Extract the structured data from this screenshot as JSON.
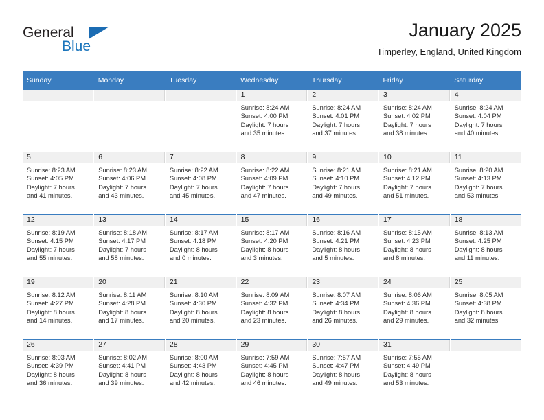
{
  "brand": {
    "name_part1": "General",
    "name_part2": "Blue",
    "accent_color": "#1b75bc",
    "triangle_color": "#1b6cb3"
  },
  "header": {
    "title": "January 2025",
    "subtitle": "Timperley, England, United Kingdom"
  },
  "theme": {
    "header_row_bg": "#3a7dc0",
    "daynum_band_bg": "#f0f0f0",
    "week_separator": "#3a7dc0",
    "text_color": "#1a1a1a"
  },
  "weekdays": [
    "Sunday",
    "Monday",
    "Tuesday",
    "Wednesday",
    "Thursday",
    "Friday",
    "Saturday"
  ],
  "weeks": [
    [
      {
        "day": "",
        "empty": true
      },
      {
        "day": "",
        "empty": true
      },
      {
        "day": "",
        "empty": true
      },
      {
        "day": "1",
        "sunrise": "Sunrise: 8:24 AM",
        "sunset": "Sunset: 4:00 PM",
        "daylight1": "Daylight: 7 hours",
        "daylight2": "and 35 minutes."
      },
      {
        "day": "2",
        "sunrise": "Sunrise: 8:24 AM",
        "sunset": "Sunset: 4:01 PM",
        "daylight1": "Daylight: 7 hours",
        "daylight2": "and 37 minutes."
      },
      {
        "day": "3",
        "sunrise": "Sunrise: 8:24 AM",
        "sunset": "Sunset: 4:02 PM",
        "daylight1": "Daylight: 7 hours",
        "daylight2": "and 38 minutes."
      },
      {
        "day": "4",
        "sunrise": "Sunrise: 8:24 AM",
        "sunset": "Sunset: 4:04 PM",
        "daylight1": "Daylight: 7 hours",
        "daylight2": "and 40 minutes."
      }
    ],
    [
      {
        "day": "5",
        "sunrise": "Sunrise: 8:23 AM",
        "sunset": "Sunset: 4:05 PM",
        "daylight1": "Daylight: 7 hours",
        "daylight2": "and 41 minutes."
      },
      {
        "day": "6",
        "sunrise": "Sunrise: 8:23 AM",
        "sunset": "Sunset: 4:06 PM",
        "daylight1": "Daylight: 7 hours",
        "daylight2": "and 43 minutes."
      },
      {
        "day": "7",
        "sunrise": "Sunrise: 8:22 AM",
        "sunset": "Sunset: 4:08 PM",
        "daylight1": "Daylight: 7 hours",
        "daylight2": "and 45 minutes."
      },
      {
        "day": "8",
        "sunrise": "Sunrise: 8:22 AM",
        "sunset": "Sunset: 4:09 PM",
        "daylight1": "Daylight: 7 hours",
        "daylight2": "and 47 minutes."
      },
      {
        "day": "9",
        "sunrise": "Sunrise: 8:21 AM",
        "sunset": "Sunset: 4:10 PM",
        "daylight1": "Daylight: 7 hours",
        "daylight2": "and 49 minutes."
      },
      {
        "day": "10",
        "sunrise": "Sunrise: 8:21 AM",
        "sunset": "Sunset: 4:12 PM",
        "daylight1": "Daylight: 7 hours",
        "daylight2": "and 51 minutes."
      },
      {
        "day": "11",
        "sunrise": "Sunrise: 8:20 AM",
        "sunset": "Sunset: 4:13 PM",
        "daylight1": "Daylight: 7 hours",
        "daylight2": "and 53 minutes."
      }
    ],
    [
      {
        "day": "12",
        "sunrise": "Sunrise: 8:19 AM",
        "sunset": "Sunset: 4:15 PM",
        "daylight1": "Daylight: 7 hours",
        "daylight2": "and 55 minutes."
      },
      {
        "day": "13",
        "sunrise": "Sunrise: 8:18 AM",
        "sunset": "Sunset: 4:17 PM",
        "daylight1": "Daylight: 7 hours",
        "daylight2": "and 58 minutes."
      },
      {
        "day": "14",
        "sunrise": "Sunrise: 8:17 AM",
        "sunset": "Sunset: 4:18 PM",
        "daylight1": "Daylight: 8 hours",
        "daylight2": "and 0 minutes."
      },
      {
        "day": "15",
        "sunrise": "Sunrise: 8:17 AM",
        "sunset": "Sunset: 4:20 PM",
        "daylight1": "Daylight: 8 hours",
        "daylight2": "and 3 minutes."
      },
      {
        "day": "16",
        "sunrise": "Sunrise: 8:16 AM",
        "sunset": "Sunset: 4:21 PM",
        "daylight1": "Daylight: 8 hours",
        "daylight2": "and 5 minutes."
      },
      {
        "day": "17",
        "sunrise": "Sunrise: 8:15 AM",
        "sunset": "Sunset: 4:23 PM",
        "daylight1": "Daylight: 8 hours",
        "daylight2": "and 8 minutes."
      },
      {
        "day": "18",
        "sunrise": "Sunrise: 8:13 AM",
        "sunset": "Sunset: 4:25 PM",
        "daylight1": "Daylight: 8 hours",
        "daylight2": "and 11 minutes."
      }
    ],
    [
      {
        "day": "19",
        "sunrise": "Sunrise: 8:12 AM",
        "sunset": "Sunset: 4:27 PM",
        "daylight1": "Daylight: 8 hours",
        "daylight2": "and 14 minutes."
      },
      {
        "day": "20",
        "sunrise": "Sunrise: 8:11 AM",
        "sunset": "Sunset: 4:28 PM",
        "daylight1": "Daylight: 8 hours",
        "daylight2": "and 17 minutes."
      },
      {
        "day": "21",
        "sunrise": "Sunrise: 8:10 AM",
        "sunset": "Sunset: 4:30 PM",
        "daylight1": "Daylight: 8 hours",
        "daylight2": "and 20 minutes."
      },
      {
        "day": "22",
        "sunrise": "Sunrise: 8:09 AM",
        "sunset": "Sunset: 4:32 PM",
        "daylight1": "Daylight: 8 hours",
        "daylight2": "and 23 minutes."
      },
      {
        "day": "23",
        "sunrise": "Sunrise: 8:07 AM",
        "sunset": "Sunset: 4:34 PM",
        "daylight1": "Daylight: 8 hours",
        "daylight2": "and 26 minutes."
      },
      {
        "day": "24",
        "sunrise": "Sunrise: 8:06 AM",
        "sunset": "Sunset: 4:36 PM",
        "daylight1": "Daylight: 8 hours",
        "daylight2": "and 29 minutes."
      },
      {
        "day": "25",
        "sunrise": "Sunrise: 8:05 AM",
        "sunset": "Sunset: 4:38 PM",
        "daylight1": "Daylight: 8 hours",
        "daylight2": "and 32 minutes."
      }
    ],
    [
      {
        "day": "26",
        "sunrise": "Sunrise: 8:03 AM",
        "sunset": "Sunset: 4:39 PM",
        "daylight1": "Daylight: 8 hours",
        "daylight2": "and 36 minutes."
      },
      {
        "day": "27",
        "sunrise": "Sunrise: 8:02 AM",
        "sunset": "Sunset: 4:41 PM",
        "daylight1": "Daylight: 8 hours",
        "daylight2": "and 39 minutes."
      },
      {
        "day": "28",
        "sunrise": "Sunrise: 8:00 AM",
        "sunset": "Sunset: 4:43 PM",
        "daylight1": "Daylight: 8 hours",
        "daylight2": "and 42 minutes."
      },
      {
        "day": "29",
        "sunrise": "Sunrise: 7:59 AM",
        "sunset": "Sunset: 4:45 PM",
        "daylight1": "Daylight: 8 hours",
        "daylight2": "and 46 minutes."
      },
      {
        "day": "30",
        "sunrise": "Sunrise: 7:57 AM",
        "sunset": "Sunset: 4:47 PM",
        "daylight1": "Daylight: 8 hours",
        "daylight2": "and 49 minutes."
      },
      {
        "day": "31",
        "sunrise": "Sunrise: 7:55 AM",
        "sunset": "Sunset: 4:49 PM",
        "daylight1": "Daylight: 8 hours",
        "daylight2": "and 53 minutes."
      },
      {
        "day": "",
        "empty": true
      }
    ]
  ]
}
